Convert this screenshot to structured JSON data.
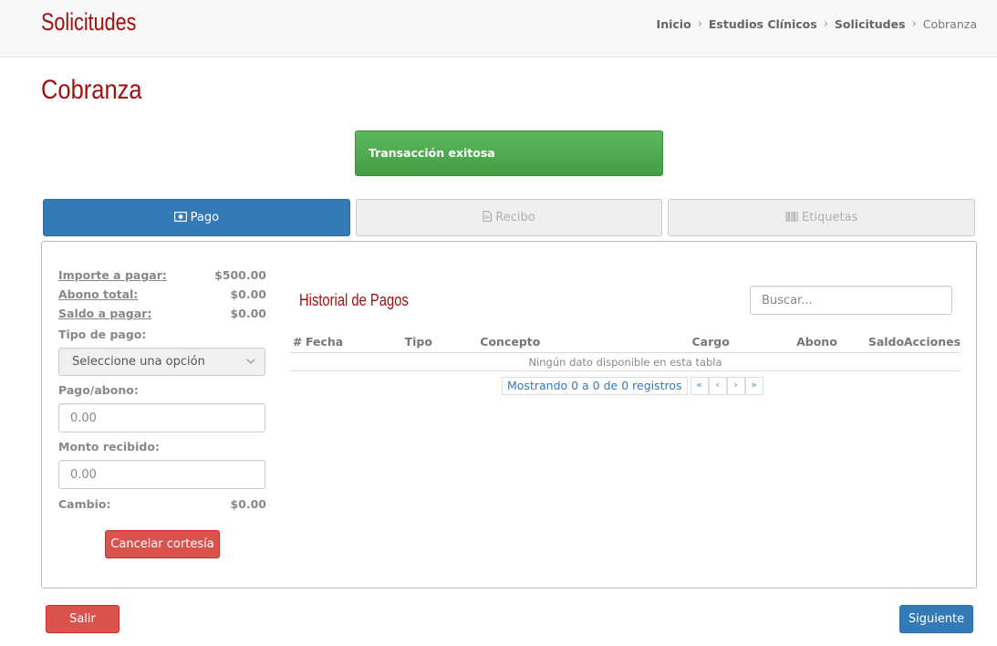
{
  "header": {
    "brand": "Solicitudes",
    "breadcrumb": [
      {
        "label": "Inicio"
      },
      {
        "label": "Estudios Clínicos"
      },
      {
        "label": "Solicitudes"
      },
      {
        "label": "Cobranza"
      }
    ],
    "separator": "›"
  },
  "page_title": "Cobranza",
  "alert": {
    "text": "Transacción exitosa",
    "color": "#5cb85c"
  },
  "tabs": [
    {
      "label": "Pago",
      "icon": "money-icon",
      "active": true
    },
    {
      "label": "Recibo",
      "icon": "file-icon",
      "active": false
    },
    {
      "label": "Etiquetas",
      "icon": "barcode-icon",
      "active": false
    }
  ],
  "payment": {
    "importe_label": "Importe a pagar:",
    "importe_value": "$500.00",
    "abono_label": "Abono total:",
    "abono_value": "$0.00",
    "saldo_label": "Saldo a pagar:",
    "saldo_value": "$0.00",
    "tipo_label": "Tipo de pago:",
    "tipo_selected": "Seleccione una opción",
    "pago_label": "Pago/abono:",
    "pago_placeholder": "0.00",
    "monto_label": "Monto recibido:",
    "monto_placeholder": "0.00",
    "cambio_label": "Cambio:",
    "cambio_value": "$0.00",
    "cortesia_button": "Cancelar cortesía"
  },
  "history": {
    "title": "Historial de Pagos",
    "search_placeholder": "Buscar...",
    "columns": [
      "#",
      "Fecha",
      "Tipo",
      "Concepto",
      "Cargo",
      "Abono",
      "Saldo",
      "Acciones"
    ],
    "empty_text": "Ningún dato disponible en esta tabla",
    "info": "Mostrando 0 a 0 de 0 registros",
    "pager": [
      "«",
      "‹",
      "›",
      "»"
    ]
  },
  "footer": {
    "exit_button": "Salir",
    "next_button": "Siguiente"
  },
  "colors": {
    "brand": "#a01010",
    "primary": "#337ab7",
    "danger": "#d9534f",
    "success": "#5cb85c"
  }
}
